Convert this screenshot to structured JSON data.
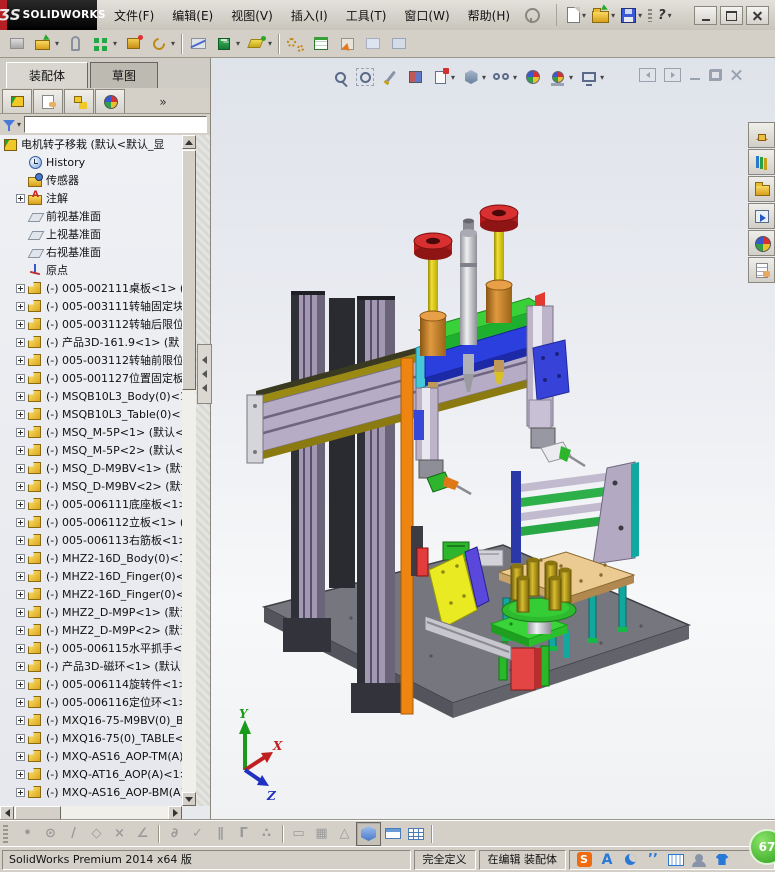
{
  "titlebar": {
    "brand_mark": "ƷS",
    "brand_name": "SOLIDWORKS",
    "menus": [
      {
        "label": "文件(F)"
      },
      {
        "label": "编辑(E)"
      },
      {
        "label": "视图(V)"
      },
      {
        "label": "插入(I)"
      },
      {
        "label": "工具(T)"
      },
      {
        "label": "窗口(W)"
      },
      {
        "label": "帮助(H)"
      }
    ],
    "quick_icons": [
      "new-document",
      "open",
      "save",
      "print",
      "help"
    ],
    "window_buttons": [
      "minimize",
      "maximize",
      "close"
    ]
  },
  "toolbar": {
    "buttons": [
      {
        "n": "edit-component",
        "g": "g-editcomp"
      },
      {
        "n": "insert-components",
        "g": "g-insert",
        "wrap": "dd"
      },
      {
        "n": "mate",
        "g": "g-mate"
      },
      {
        "n": "linear-component-pattern",
        "g": "g-pattern",
        "wrap": "dd"
      },
      {
        "n": "smart-fasteners",
        "g": "g-fastener"
      },
      {
        "n": "move-component",
        "g": "g-move",
        "wrap": "dd"
      },
      {
        "wrap": "tsep"
      },
      {
        "n": "show-hidden-components",
        "g": "g-hidden"
      },
      {
        "n": "assembly-features",
        "g": "g-asmfeat",
        "wrap": "dd"
      },
      {
        "n": "reference-geometry",
        "g": "g-refgeo",
        "wrap": "dd"
      },
      {
        "wrap": "tsep"
      },
      {
        "n": "new-motion-study",
        "g": "g-motion"
      },
      {
        "n": "bill-of-materials",
        "g": "g-bom"
      },
      {
        "n": "exploded-view",
        "g": "g-explode"
      },
      {
        "n": "instant3d",
        "g": "g-pale"
      },
      {
        "n": "large-design-review",
        "g": "g-pale2"
      }
    ]
  },
  "command_tabs": {
    "assembly": "装配体",
    "sketch": "草图"
  },
  "panel_tabs": [
    "featuremanager-design-tree",
    "propertymanager",
    "configurationmanager",
    "displaymanager"
  ],
  "panel_more": "»",
  "tree": {
    "root_label": "电机转子移栽 (默认<默认_显",
    "items": [
      {
        "g": "ti-history",
        "label": "History"
      },
      {
        "g": "ti-sensors",
        "label": "传感器"
      },
      {
        "g": "ti-ann",
        "plus": "plus",
        "label": "注解"
      },
      {
        "g": "ti-plane",
        "label": "前视基准面"
      },
      {
        "g": "ti-plane",
        "label": "上视基准面"
      },
      {
        "g": "ti-plane",
        "label": "右视基准面"
      },
      {
        "g": "ti-origin",
        "label": "原点"
      },
      {
        "g": "ti-part",
        "plus": "plus",
        "label": "(-) 005-002111桌板<1> ("
      },
      {
        "g": "ti-part",
        "plus": "plus",
        "label": "(-) 005-003111转轴固定块"
      },
      {
        "g": "ti-part",
        "plus": "plus",
        "label": "(-) 005-003112转轴后限位"
      },
      {
        "g": "ti-part",
        "plus": "plus",
        "label": "(-) 产品3D-161.9<1> (默"
      },
      {
        "g": "ti-part",
        "plus": "plus",
        "label": "(-) 005-003112转轴前限位"
      },
      {
        "g": "ti-part",
        "plus": "plus",
        "label": "(-) 005-001127位置固定板"
      },
      {
        "g": "ti-part",
        "plus": "plus",
        "label": "(-) MSQB10L3_Body(0)<1>"
      },
      {
        "g": "ti-part",
        "plus": "plus",
        "label": "(-) MSQB10L3_Table(0)<1"
      },
      {
        "g": "ti-part",
        "plus": "plus",
        "label": "(-) MSQ_M-5P<1> (默认<<"
      },
      {
        "g": "ti-part",
        "plus": "plus",
        "label": "(-) MSQ_M-5P<2> (默认<<"
      },
      {
        "g": "ti-part",
        "plus": "plus",
        "label": "(-) MSQ_D-M9BV<1> (默认"
      },
      {
        "g": "ti-part",
        "plus": "plus",
        "label": "(-) MSQ_D-M9BV<2> (默认"
      },
      {
        "g": "ti-part",
        "plus": "plus",
        "label": "(-) 005-006111底座板<1>"
      },
      {
        "g": "ti-part",
        "plus": "plus",
        "label": "(-) 005-006112立板<1> ("
      },
      {
        "g": "ti-part",
        "plus": "plus",
        "label": "(-) 005-006113右筋板<1>"
      },
      {
        "g": "ti-part",
        "plus": "plus",
        "label": "(-) MHZ2-16D_Body(0)<1>"
      },
      {
        "g": "ti-part",
        "plus": "plus",
        "label": "(-) MHZ2-16D_Finger(0)<"
      },
      {
        "g": "ti-part",
        "plus": "plus",
        "label": "(-) MHZ2-16D_Finger(0)<"
      },
      {
        "g": "ti-part",
        "plus": "plus",
        "label": "(-) MHZ2_D-M9P<1> (默认"
      },
      {
        "g": "ti-part",
        "plus": "plus",
        "label": "(-) MHZ2_D-M9P<2> (默认"
      },
      {
        "g": "ti-part",
        "plus": "plus",
        "label": "(-) 005-006115水平抓手<"
      },
      {
        "g": "ti-part",
        "plus": "plus",
        "label": "(-) 产品3D-磁环<1> (默认"
      },
      {
        "g": "ti-part",
        "plus": "plus",
        "label": "(-) 005-006114旋转件<1>"
      },
      {
        "g": "ti-part",
        "plus": "plus",
        "label": "(-) 005-006116定位环<1>"
      },
      {
        "g": "ti-part",
        "plus": "plus",
        "label": "(-) MXQ16-75-M9BV(0)_BO"
      },
      {
        "g": "ti-part",
        "plus": "plus",
        "label": "(-) MXQ16-75(0)_TABLE<1"
      },
      {
        "g": "ti-part",
        "plus": "plus",
        "label": "(-) MXQ-AS16_AOP-TM(A)<"
      },
      {
        "g": "ti-part",
        "plus": "plus",
        "label": "(-) MXQ-AT16_AOP(A)<1>"
      },
      {
        "g": "ti-part",
        "plus": "plus",
        "label": "(-) MXQ-AS16_AOP-BM(A)<"
      }
    ]
  },
  "headsup": {
    "buttons": [
      {
        "n": "zoom-to-fit",
        "g": "h-zoomfit"
      },
      {
        "n": "zoom-to-area",
        "g": "h-zoomarea"
      },
      {
        "n": "previous-view",
        "g": "h-prev"
      },
      {
        "n": "section-view",
        "g": "h-section"
      },
      {
        "n": "view-orientation",
        "g": "h-vieworient",
        "wrap": "dd"
      },
      {
        "n": "display-style",
        "g": "h-dispstyle",
        "wrap": "dd"
      },
      {
        "n": "hide-show-items",
        "g": "h-hideshow",
        "wrap": "dd"
      },
      {
        "n": "edit-appearance",
        "g": "h-appearance"
      },
      {
        "n": "apply-scene",
        "g": "h-scene",
        "wrap": "dd"
      },
      {
        "n": "view-settings",
        "g": "h-viewset",
        "wrap": "dd"
      }
    ]
  },
  "pane_controls": [
    "collapse-left",
    "collapse-right",
    "minimize-child",
    "restore-child",
    "close-child"
  ],
  "taskpane": [
    {
      "n": "solidworks-resources",
      "g": "t-home"
    },
    {
      "n": "design-library",
      "g": "t-library"
    },
    {
      "n": "file-explorer",
      "g": "t-explorer"
    },
    {
      "n": "view-palette",
      "g": "t-palette"
    },
    {
      "n": "appearances-scenes",
      "g": "t-appear"
    },
    {
      "n": "custom-properties",
      "g": "t-props"
    }
  ],
  "bottom_toolbar": {
    "items": [
      {
        "n": "sketch-point",
        "ch": "•"
      },
      {
        "n": "sketch-circle",
        "ch": "⊙"
      },
      {
        "n": "sketch-line",
        "ch": "/"
      },
      {
        "n": "sketch-polygon",
        "ch": "◇"
      },
      {
        "n": "sketch-trim",
        "ch": "×"
      },
      {
        "n": "sketch-angle",
        "ch": "∠"
      },
      {
        "wrap": "bsep"
      },
      {
        "n": "snap-tangent",
        "ch": "∂"
      },
      {
        "n": "snap-check",
        "ch": "✓"
      },
      {
        "n": "snap-parallel",
        "ch": "∥"
      },
      {
        "n": "snap-perpendicular",
        "ch": "Γ"
      },
      {
        "n": "snap-points",
        "ch": "∴"
      },
      {
        "wrap": "bsep"
      },
      {
        "n": "snap-length",
        "ch": "▭"
      },
      {
        "n": "snap-grid",
        "ch": "▦"
      },
      {
        "n": "snap-angle-value",
        "ch": "△"
      },
      {
        "n": "view-cube",
        "g": "b-cube",
        "wrap": "on"
      },
      {
        "n": "view-single",
        "g": "b-plane"
      },
      {
        "n": "view-multiple",
        "g": "b-table"
      },
      {
        "wrap": "bsep"
      }
    ]
  },
  "statusbar": {
    "app_version": "SolidWorks Premium 2014 x64 版",
    "define_state": "完全定义",
    "edit_state": "在编辑 装配体",
    "tray": [
      {
        "n": "sogou-logo",
        "g": "s-sogou"
      },
      {
        "n": "input-letter",
        "g": "s-a"
      },
      {
        "n": "input-moon",
        "g": "s-moon"
      },
      {
        "n": "input-punctuation",
        "g": "s-quote"
      },
      {
        "n": "soft-keyboard",
        "g": "s-kbd"
      },
      {
        "n": "input-person",
        "g": "s-person"
      },
      {
        "n": "input-skin",
        "g": "s-shirt"
      }
    ],
    "bubble_value": "67"
  },
  "viewport": {
    "triad": {
      "x": "X",
      "y": "Y",
      "z": "Z"
    }
  },
  "colors": {
    "accent_red": "#b51f24",
    "chrome": "#d4d0c8",
    "viewport_top": "#dfe3ea",
    "orange_belt": "#ee8511",
    "green_part": "#2dcb2d",
    "blue_part": "#2b3ede",
    "yellow_rod": "#dcc80a",
    "lavender_extrusion": "#b3a9c2",
    "base_gray": "#76767e",
    "table_tan": "#ecca92",
    "teal_leg": "#12a8a0",
    "brass": "#b89a18",
    "bubble_green": "#2f9e1f"
  }
}
